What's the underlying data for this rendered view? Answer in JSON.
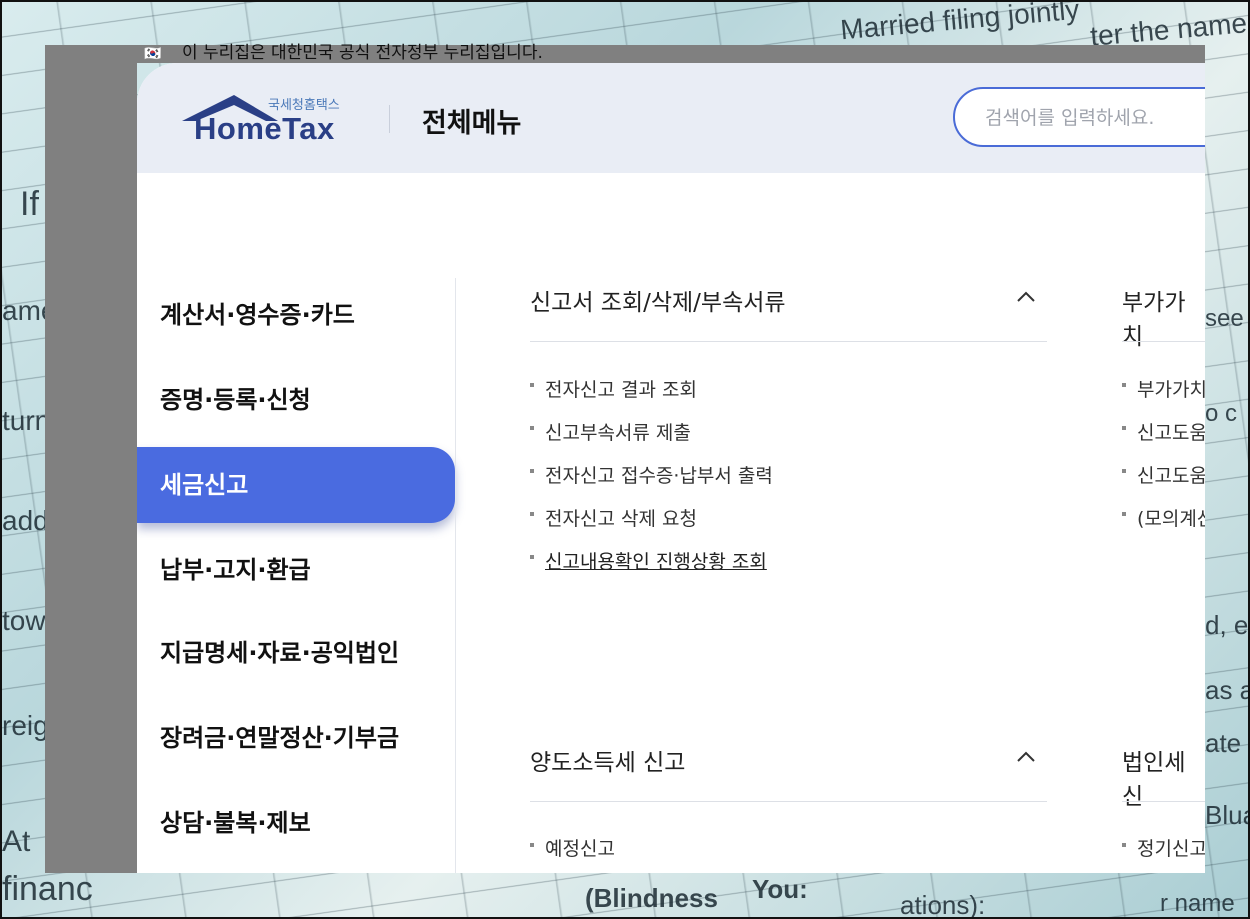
{
  "background": {
    "form_texts": [
      "Married filing jointly",
      "ter the name",
      "(Blindness",
      "You:",
      "ations):",
      "r name",
      "see",
      "o c",
      "d, e",
      "as a",
      "ate",
      "Bluar",
      "At",
      "financ",
      "tow",
      "reig",
      "add",
      "turn",
      "ame",
      "If"
    ]
  },
  "gov_banner": {
    "flag": "🇰🇷",
    "text": "이 누리집은 대한민국 공식 전자정부 누리집입니다."
  },
  "header": {
    "logo_small": "국세청홈택스",
    "logo_main": "HomeTax",
    "title": "전체메뉴",
    "search_placeholder": "검색어를 입력하세요."
  },
  "sidebar": {
    "items": [
      {
        "label": "계산서·영수증·카드",
        "active": false
      },
      {
        "label": "증명·등록·신청",
        "active": false
      },
      {
        "label": "세금신고",
        "active": true
      },
      {
        "label": "납부·고지·환급",
        "active": false
      },
      {
        "label": "지급명세·자료·공익법인",
        "active": false
      },
      {
        "label": "장려금·연말정산·기부금",
        "active": false
      },
      {
        "label": "상담·불복·제보",
        "active": false
      }
    ]
  },
  "sections": {
    "s1": {
      "title": "신고서 조회/삭제/부속서류",
      "items": [
        "전자신고 결과 조회",
        "신고부속서류 제출",
        "전자신고 접수증·납부서 출력",
        "전자신고 삭제 요청",
        "신고내용확인 진행상황 조회"
      ]
    },
    "s2": {
      "title": "부가가치",
      "items": [
        "부가가치",
        "신고도움",
        "신고도움",
        "(모의계산"
      ]
    },
    "s3": {
      "title": "양도소득세 신고",
      "items": [
        "예정신고"
      ]
    },
    "s4": {
      "title": "법인세 신",
      "items": [
        "정기신고"
      ]
    }
  },
  "colors": {
    "accent": "#4a6be0",
    "header_bg": "#e9edf5",
    "logo_blue": "#2a3f86"
  }
}
